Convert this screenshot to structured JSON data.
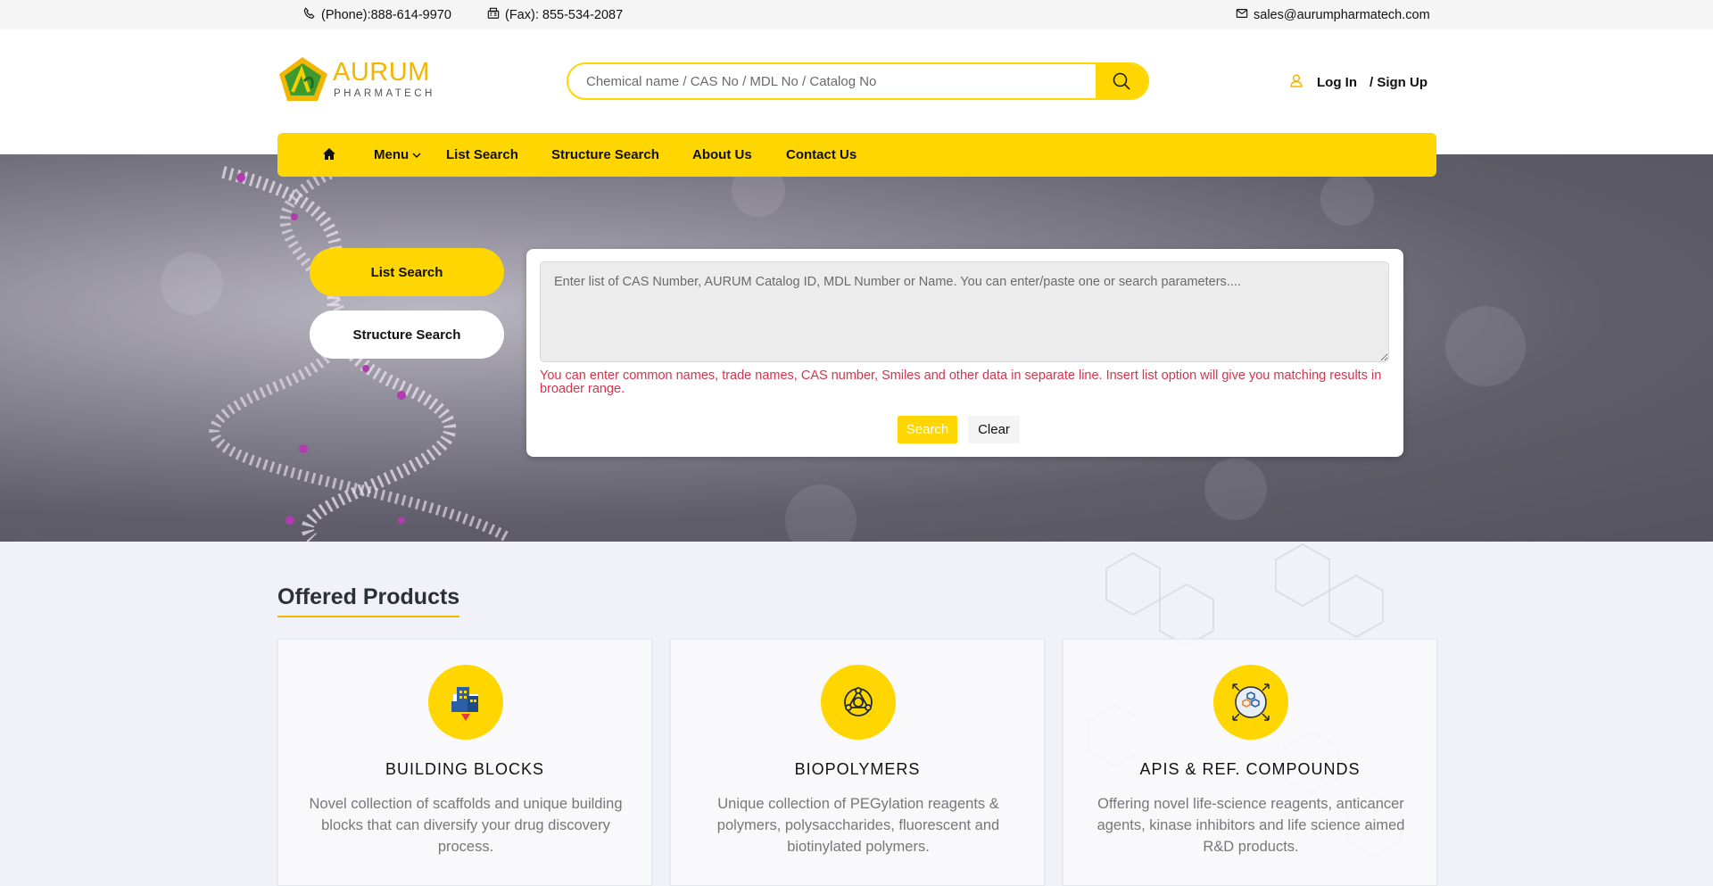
{
  "topbar": {
    "phone": "(Phone):888-614-9970",
    "fax": "(Fax): 855-534-2087",
    "email": "sales@aurumpharmatech.com"
  },
  "header": {
    "logo_brand": "AURUM",
    "logo_sub": "PHARMATECH",
    "search_placeholder": "Chemical name / CAS No / MDL No / Catalog No",
    "login": "Log In",
    "signup": "/ Sign Up"
  },
  "nav": {
    "menu": "Menu",
    "list_search": "List Search",
    "structure_search": "Structure Search",
    "about": "About Us",
    "contact": "Contact Us"
  },
  "hero": {
    "list_search_btn": "List Search",
    "structure_search_btn": "Structure Search",
    "textarea_placeholder": "Enter list of CAS Number, AURUM Catalog ID, MDL Number or Name. You can enter/paste one or search parameters....",
    "hint": "You can enter common names, trade names, CAS number, Smiles and other data in separate line. Insert list option will give you matching results in broader range.",
    "search_btn": "Search",
    "clear_btn": "Clear"
  },
  "products": {
    "title": "Offered Products",
    "items": [
      {
        "title": "BUILDING BLOCKS",
        "desc": "Novel collection of scaffolds and unique building blocks that can diversify your drug discovery process.",
        "icon": "building-blocks-icon"
      },
      {
        "title": "BIOPOLYMERS",
        "desc": "Unique collection of PEGylation reagents & polymers, polysaccharides, fluorescent and biotinylated polymers.",
        "icon": "biopolymer-icon"
      },
      {
        "title": "APIS & REF. COMPOUNDS",
        "desc": "Offering novel life-science reagents, anticancer agents, kinase inhibitors and life science aimed R&D products.",
        "icon": "compound-icon"
      }
    ]
  },
  "colors": {
    "accent": "#ffd600",
    "hint": "#d6334d"
  }
}
